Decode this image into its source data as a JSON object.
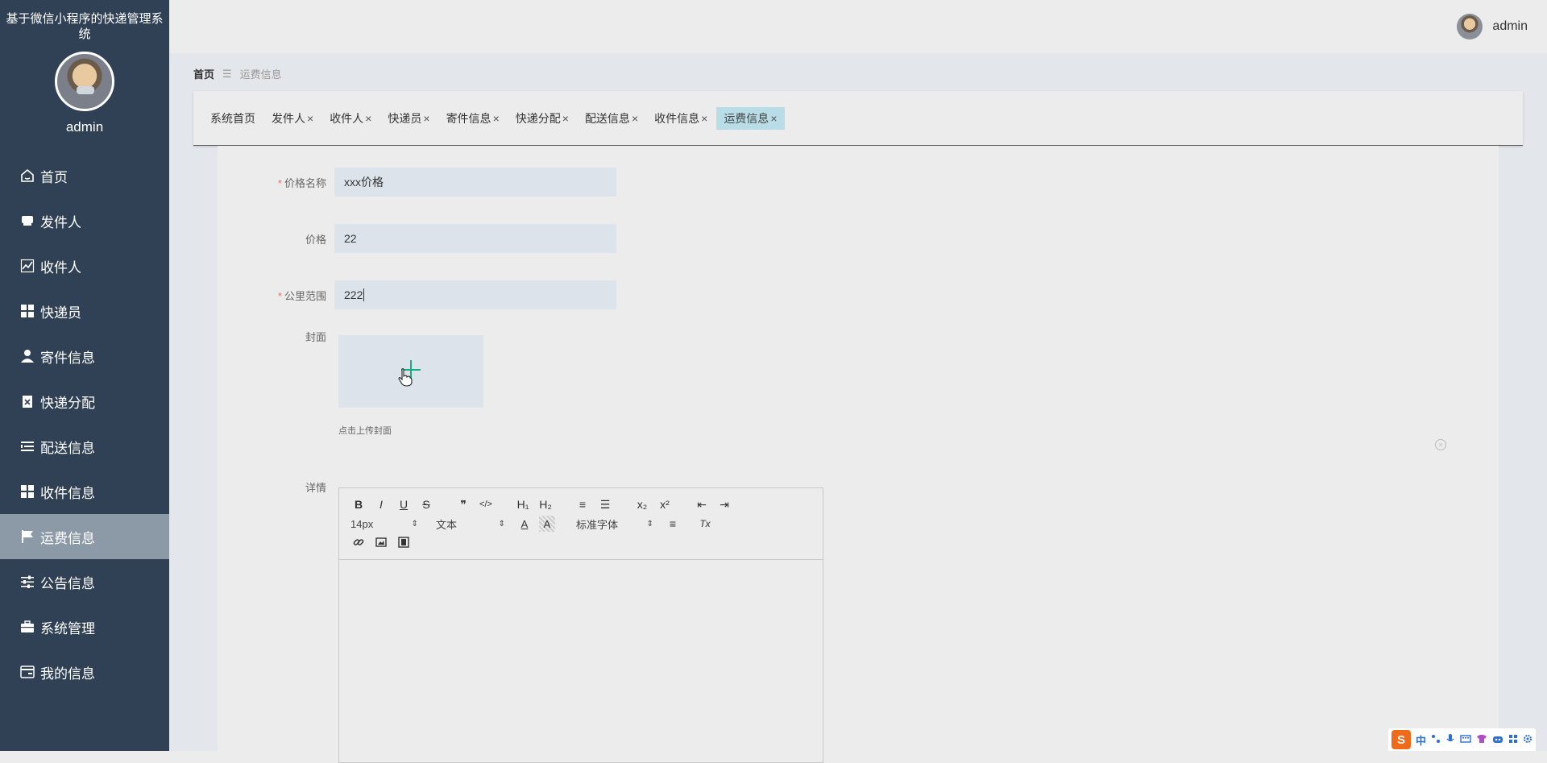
{
  "sidebar": {
    "system_title": "基于微信小程序的快递管理系统",
    "username": "admin",
    "items": [
      {
        "label": "首页",
        "icon": "home-icon"
      },
      {
        "label": "发件人",
        "icon": "sender-icon"
      },
      {
        "label": "收件人",
        "icon": "chart-icon"
      },
      {
        "label": "快递员",
        "icon": "grid-icon"
      },
      {
        "label": "寄件信息",
        "icon": "user-icon"
      },
      {
        "label": "快递分配",
        "icon": "clipboard-icon"
      },
      {
        "label": "配送信息",
        "icon": "list-icon"
      },
      {
        "label": "收件信息",
        "icon": "grid-icon"
      },
      {
        "label": "运费信息",
        "icon": "flag-icon",
        "active": true
      },
      {
        "label": "公告信息",
        "icon": "sliders-icon"
      },
      {
        "label": "系统管理",
        "icon": "briefcase-icon"
      },
      {
        "label": "我的信息",
        "icon": "card-icon"
      }
    ]
  },
  "header": {
    "username": "admin"
  },
  "breadcrumb": {
    "home": "首页",
    "separator": "☰",
    "current": "运费信息"
  },
  "tags": [
    {
      "label": "系统首页",
      "closable": false
    },
    {
      "label": "发件人",
      "closable": true
    },
    {
      "label": "收件人",
      "closable": true
    },
    {
      "label": "快递员",
      "closable": true
    },
    {
      "label": "寄件信息",
      "closable": true
    },
    {
      "label": "快递分配",
      "closable": true
    },
    {
      "label": "配送信息",
      "closable": true
    },
    {
      "label": "收件信息",
      "closable": true
    },
    {
      "label": "运费信息",
      "closable": true,
      "active": true
    }
  ],
  "tag_close_glyph": "×",
  "form": {
    "price_name": {
      "label": "价格名称",
      "required": "*",
      "value": "xxx价格"
    },
    "price": {
      "label": "价格",
      "value": "22"
    },
    "km_range": {
      "label": "公里范围",
      "required": "*",
      "value": "222"
    },
    "cover": {
      "label": "封面",
      "tip": "点击上传封面"
    },
    "detail": {
      "label": "详情"
    }
  },
  "editor": {
    "row1": [
      "B",
      "I",
      "U",
      "S",
      "❞",
      "</>",
      "H₁",
      "H₂",
      "≡",
      "☰",
      "x₂",
      "x²",
      "⇤",
      "⇥"
    ],
    "font_size": "14px",
    "text_type": "文本",
    "font_family": "标准字体",
    "color_a": "A",
    "bg_a": "A",
    "clear_format": "Tx",
    "select_arrow": "⇕",
    "align": "≡"
  },
  "ime": {
    "logo": "S",
    "mode": "中"
  },
  "colors": {
    "sidebar": "#304156",
    "active_menu": "#8c99a6",
    "active_tag": "#b9dde6",
    "required": "#f56c6c",
    "upload_plus": "#13ae82"
  }
}
